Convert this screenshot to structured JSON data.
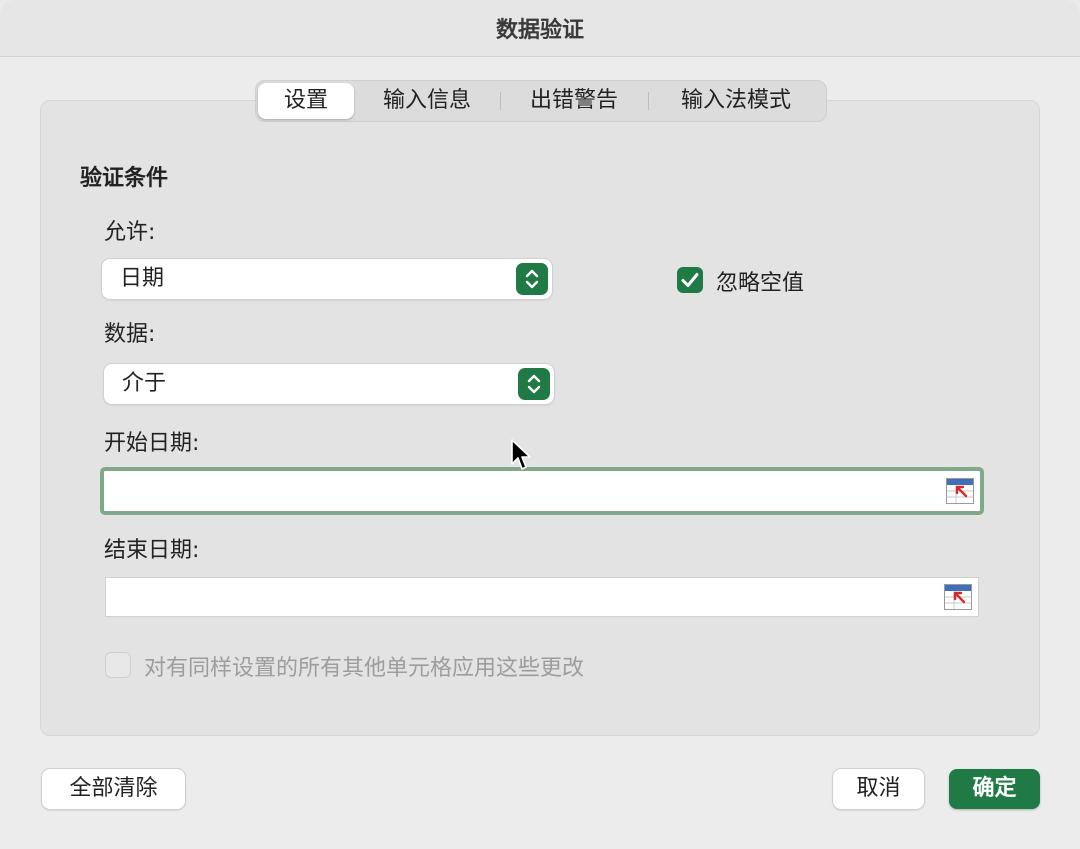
{
  "window": {
    "title": "数据验证"
  },
  "tabs": [
    {
      "label": "设置",
      "active": true
    },
    {
      "label": "输入信息",
      "active": false
    },
    {
      "label": "出错警告",
      "active": false
    },
    {
      "label": "输入法模式",
      "active": false
    }
  ],
  "settings": {
    "section_title": "验证条件",
    "allow": {
      "label": "允许:",
      "value": "日期"
    },
    "ignore_blank": {
      "label": "忽略空值",
      "checked": true
    },
    "data": {
      "label": "数据:",
      "value": "介于"
    },
    "start_date": {
      "label": "开始日期:",
      "value": ""
    },
    "end_date": {
      "label": "结束日期:",
      "value": ""
    },
    "apply_all": {
      "label": "对有同样设置的所有其他单元格应用这些更改",
      "checked": false,
      "disabled": true
    }
  },
  "buttons": {
    "clear_all": "全部清除",
    "cancel": "取消",
    "ok": "确定"
  },
  "colors": {
    "accent": "#1f7a45",
    "focus_ring": "#7fa98a"
  },
  "icons": {
    "stepper": "up-down-chevron-icon",
    "checkmark": "checkmark-icon",
    "range_picker": "collapse-dialog-range-icon",
    "cursor": "mouse-pointer-icon"
  }
}
